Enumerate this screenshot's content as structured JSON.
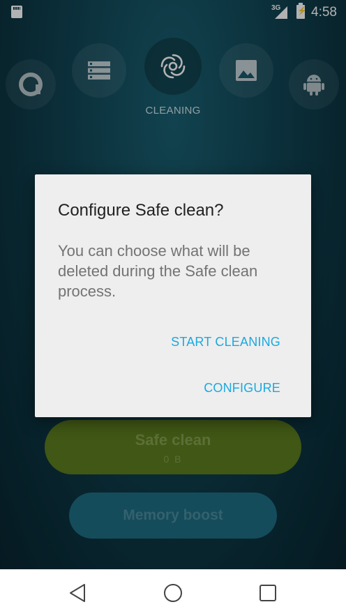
{
  "status_bar": {
    "network": "3G",
    "time": "4:58"
  },
  "categories": [
    {
      "icon": "avast-logo-icon"
    },
    {
      "icon": "storage-icon"
    },
    {
      "icon": "cleaning-swirl-icon",
      "label": "CLEANING",
      "active": true
    },
    {
      "icon": "image-icon"
    },
    {
      "icon": "android-icon"
    }
  ],
  "active_category_label": "CLEANING",
  "main": {
    "safe_clean_label": "Safe clean",
    "safe_clean_size": "0 B",
    "memory_boost_label": "Memory boost"
  },
  "dialog": {
    "title": "Configure Safe clean?",
    "message": "You can choose what will be deleted during the Safe clean process.",
    "start_button": "START CLEANING",
    "configure_button": "CONFIGURE"
  },
  "colors": {
    "accent": "#1aa9e0",
    "safe_clean_bg": "#5c7d1f",
    "memory_boost_bg": "#1e6d83"
  },
  "nav": {
    "back": "back-icon",
    "home": "home-icon",
    "recent": "recent-apps-icon"
  }
}
